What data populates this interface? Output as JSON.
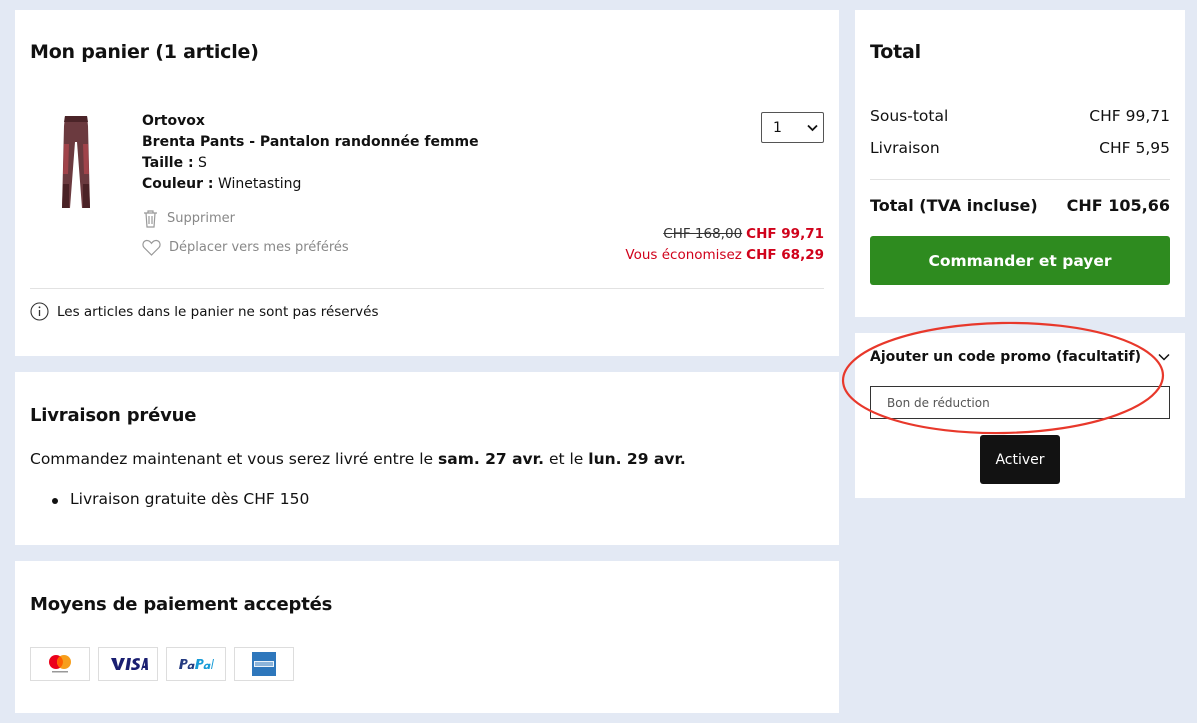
{
  "cart": {
    "title": "Mon panier (1 article)",
    "item": {
      "brand": "Ortovox",
      "name": "Brenta Pants - Pantalon randonnée femme",
      "size_label": "Taille :",
      "size": "S",
      "color_label": "Couleur :",
      "color": "Winetasting",
      "remove_label": "Supprimer",
      "favorite_label": "Déplacer vers mes préférés",
      "quantity": "1",
      "old_price": "CHF 168,00",
      "new_price": "CHF 99,71",
      "savings_label": "Vous économisez",
      "savings": "CHF 68,29"
    },
    "note": "Les articles dans le panier ne sont pas réservés"
  },
  "delivery": {
    "title": "Livraison prévue",
    "text_pre": "Commandez maintenant et vous serez livré entre le",
    "date_from": "sam. 27 avr.",
    "text_mid": "et le",
    "date_to": "lun. 29 avr.",
    "bullet": "Livraison gratuite dès CHF 150"
  },
  "payment": {
    "title": "Moyens de paiement acceptés",
    "methods": [
      "mastercard-icon",
      "visa-icon",
      "paypal-icon",
      "amex-icon"
    ]
  },
  "totals": {
    "title": "Total",
    "subtotal_label": "Sous-total",
    "subtotal": "CHF 99,71",
    "shipping_label": "Livraison",
    "shipping": "CHF 5,95",
    "total_label": "Total (TVA incluse)",
    "total": "CHF 105,66",
    "checkout_label": "Commander et payer"
  },
  "promo": {
    "title": "Ajouter un code promo (facultatif)",
    "placeholder": "Bon de réduction",
    "activate_label": "Activer"
  },
  "colors": {
    "background": "#e3e9f4",
    "sale_red": "#d0021b",
    "checkout_green": "#2e8b1f",
    "highlight_red": "#e8382b"
  }
}
